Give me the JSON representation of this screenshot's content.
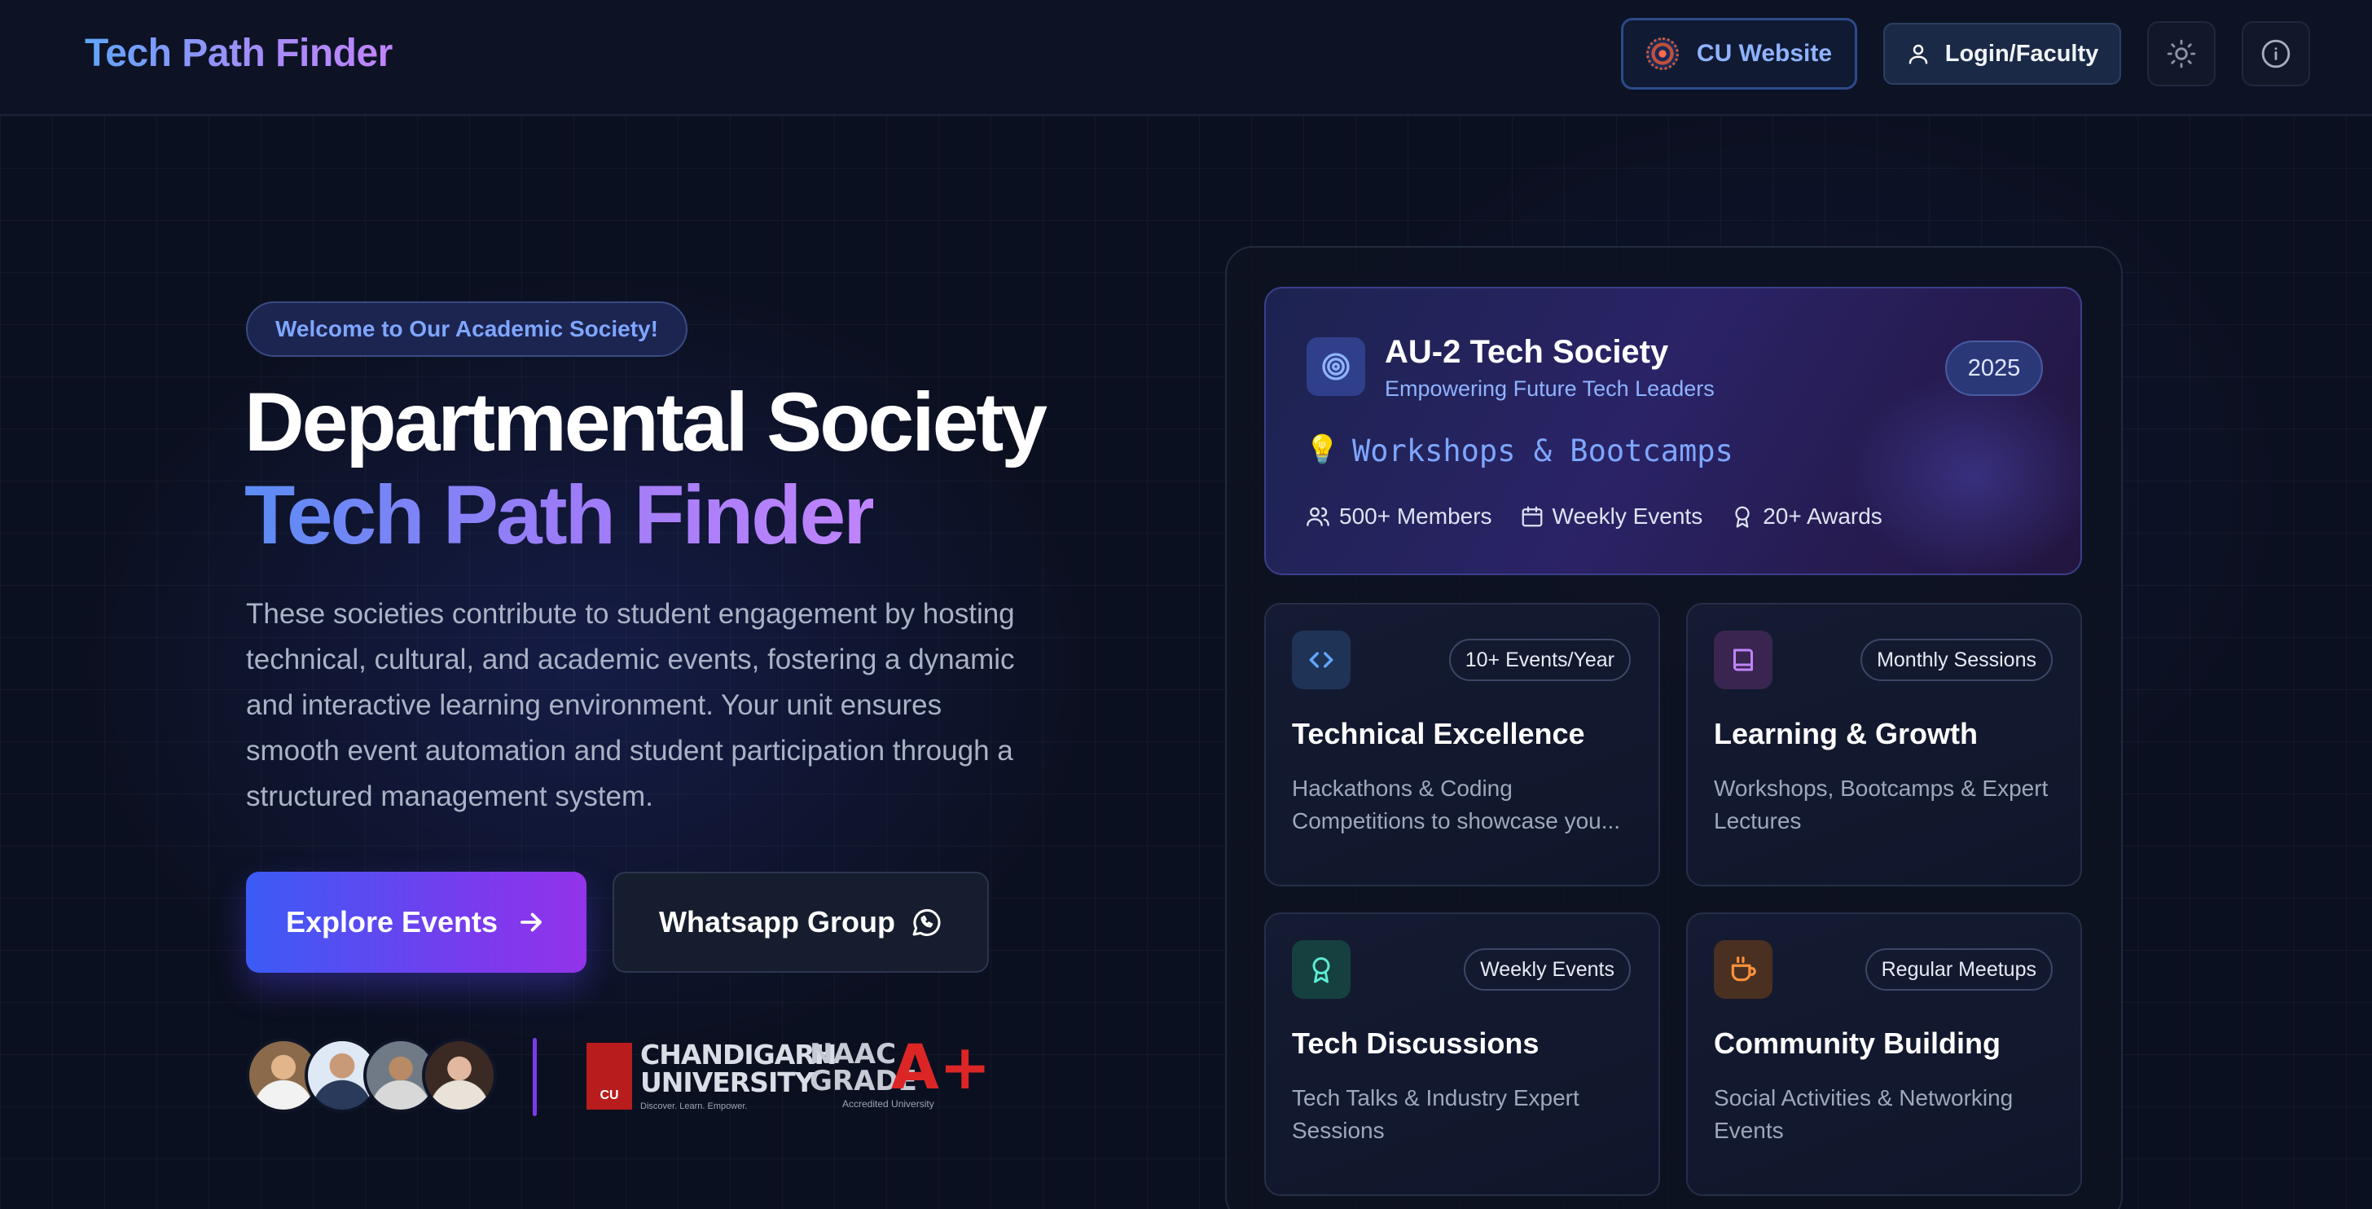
{
  "nav": {
    "brand": "Tech Path Finder",
    "cu_website_label": "CU Website",
    "login_label": "Login/Faculty"
  },
  "hero": {
    "welcome_badge": "Welcome to Our Academic Society!",
    "title_line1": "Departmental Society",
    "title_line2": "Tech Path Finder",
    "description": "These societies contribute to student engagement by hosting technical, cultural, and academic events, fostering a dynamic and interactive learning environment. Your unit ensures smooth event automation and student participation through a structured management system.",
    "explore_label": "Explore Events",
    "whatsapp_label": "Whatsapp Group"
  },
  "logos": {
    "chandigarh_line1": "CHANDIGARH",
    "chandigarh_line2": "UNIVERSITY",
    "chandigarh_tagline": "Discover. Learn. Empower.",
    "naac_line1": "NAAC",
    "naac_line2": "GRADE",
    "naac_grade": "A+",
    "naac_accredited": "Accredited University"
  },
  "feature": {
    "title": "AU-2 Tech Society",
    "subtitle": "Empowering Future Tech Leaders",
    "year": "2025",
    "typing_text": "Workshops & Bootcamps",
    "stats": [
      "500+ Members",
      "Weekly Events",
      "20+ Awards"
    ]
  },
  "cards": [
    {
      "badge": "10+ Events/Year",
      "title": "Technical Excellence",
      "description": "Hackathons & Coding Competitions to showcase you..."
    },
    {
      "badge": "Monthly Sessions",
      "title": "Learning & Growth",
      "description": "Workshops, Bootcamps & Expert Lectures"
    },
    {
      "badge": "Weekly Events",
      "title": "Tech Discussions",
      "description": "Tech Talks & Industry Expert Sessions"
    },
    {
      "badge": "Regular Meetups",
      "title": "Community Building",
      "description": "Social Activities & Networking Events"
    }
  ],
  "colors": {
    "background": "#0b1020",
    "accent_blue": "#3b5bf5",
    "accent_purple": "#7c3aed",
    "link_blue": "#7ea6ff"
  },
  "icons": {
    "theme_toggle": "sun-icon",
    "info": "info-icon",
    "login": "user-icon",
    "feature": "target-icon",
    "card_icons": [
      "code-icon",
      "book-icon",
      "award-icon",
      "coffee-icon"
    ]
  }
}
